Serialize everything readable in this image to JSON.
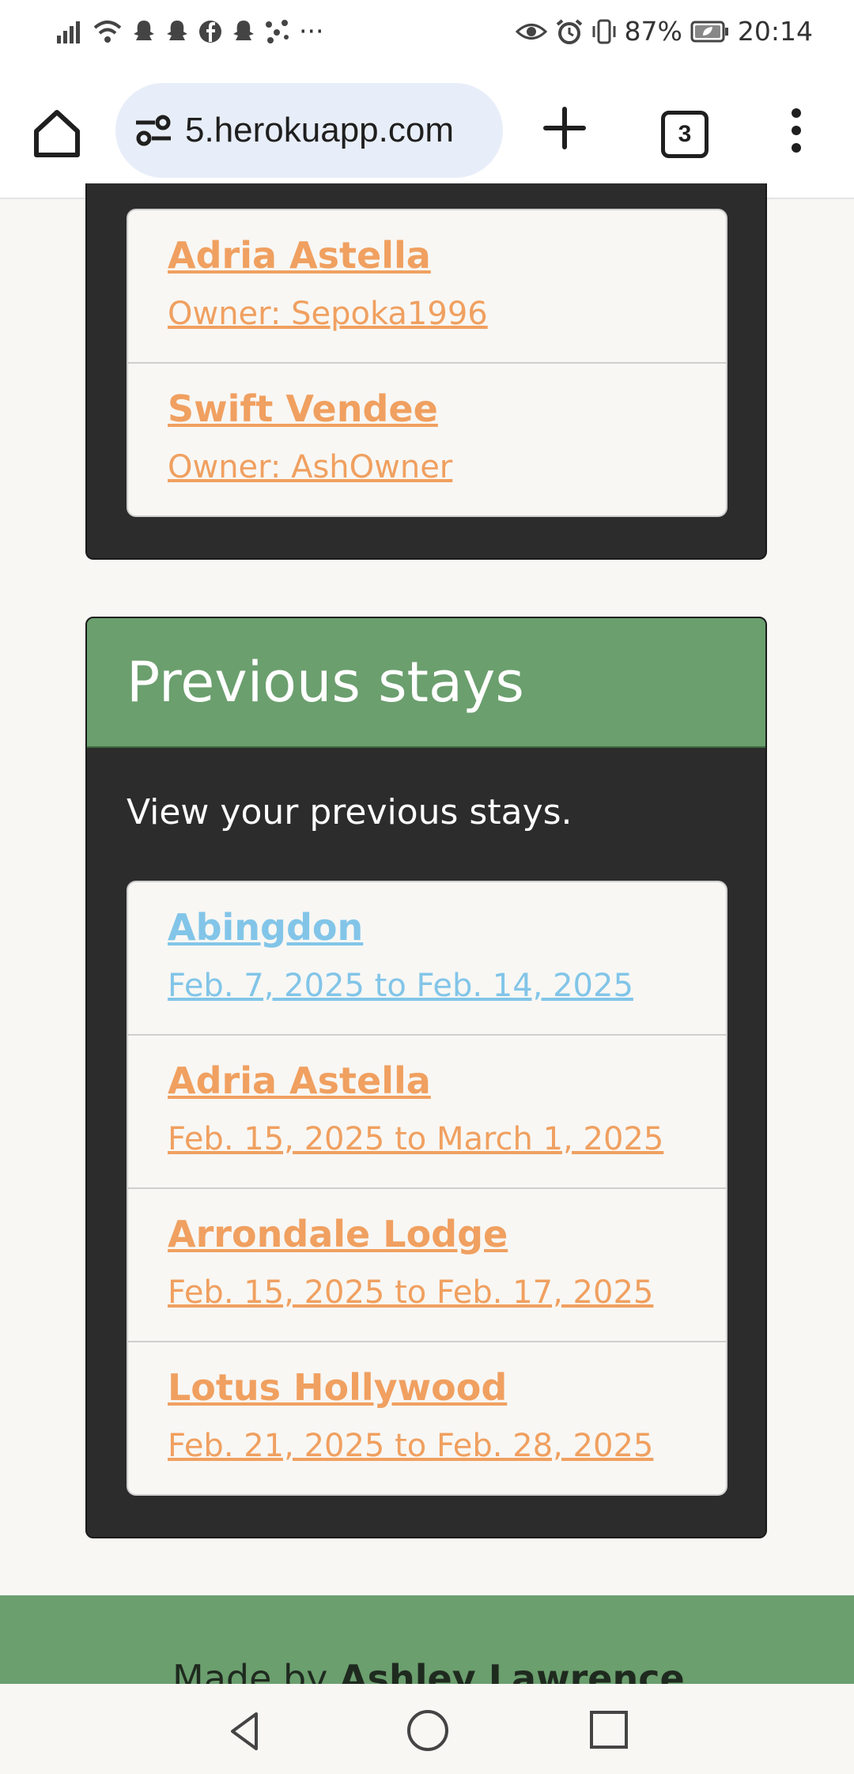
{
  "status_bar": {
    "battery": "87%",
    "time": "20:14",
    "more": "···"
  },
  "browser": {
    "url": "5.herokuapp.com",
    "tab_count": "3"
  },
  "top_card": {
    "items": [
      {
        "title": "Adria Astella",
        "subtitle": "Owner: Sepoka1996"
      },
      {
        "title": "Swift Vendee",
        "subtitle": "Owner: AshOwner"
      }
    ]
  },
  "previous_stays": {
    "title": "Previous stays",
    "description": "View your previous stays.",
    "items": [
      {
        "title": "Abingdon",
        "subtitle": "Feb. 7, 2025 to Feb. 14, 2025"
      },
      {
        "title": "Adria Astella",
        "subtitle": "Feb. 15, 2025 to March 1, 2025"
      },
      {
        "title": "Arrondale Lodge",
        "subtitle": "Feb. 15, 2025 to Feb. 17, 2025"
      },
      {
        "title": "Lotus Hollywood",
        "subtitle": "Feb. 21, 2025 to Feb. 28, 2025"
      }
    ]
  },
  "footer": {
    "made_by_prefix": "Made by",
    "author": "Ashley Lawrence"
  },
  "colors": {
    "accent_green": "#6b9f6e",
    "link_orange": "#f0a060",
    "link_visited_blue": "#82c5e8",
    "card_dark": "#2c2c2c"
  }
}
